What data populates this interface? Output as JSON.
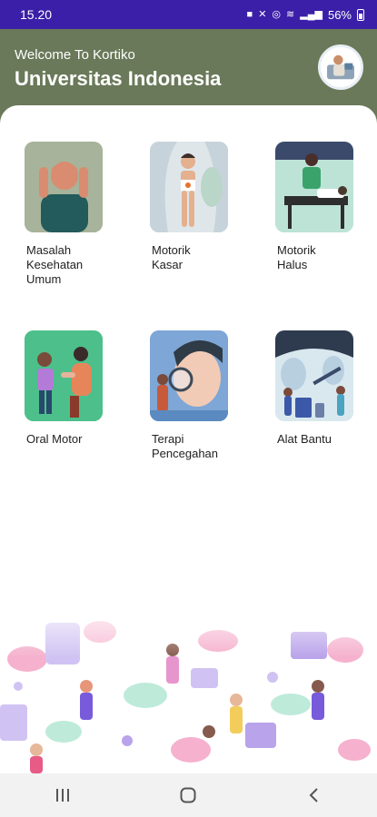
{
  "status_bar": {
    "time": "15.20",
    "battery": "56%"
  },
  "header": {
    "welcome": "Welcome To Kortiko",
    "title": "Universitas Indonesia"
  },
  "menu": [
    {
      "label": "Masalah\nKesehatan\nUmum",
      "icon": "headache-person-illustration"
    },
    {
      "label": "Motorik\nKasar",
      "icon": "body-figure-illustration"
    },
    {
      "label": "Motorik\nHalus",
      "icon": "doctor-patient-illustration"
    },
    {
      "label": "Oral Motor",
      "icon": "child-therapist-illustration"
    },
    {
      "label": "Terapi\nPencegahan",
      "icon": "magnifier-checkup-illustration"
    },
    {
      "label": "Alat Bantu",
      "icon": "medical-equipment-illustration"
    }
  ],
  "colors": {
    "status_bar": "#3b1fa8",
    "header": "#6a7959",
    "background": "#ffffff"
  }
}
